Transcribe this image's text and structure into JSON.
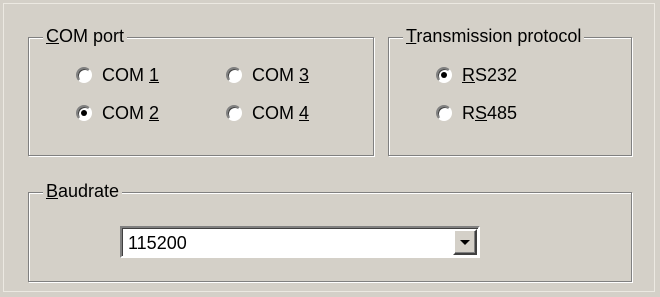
{
  "com_port": {
    "legend_first": "C",
    "legend_rest": "OM port",
    "options": [
      {
        "prefix": "COM ",
        "accel": "1",
        "selected": false
      },
      {
        "prefix": "COM ",
        "accel": "2",
        "selected": true
      },
      {
        "prefix": "COM ",
        "accel": "3",
        "selected": false
      },
      {
        "prefix": "COM ",
        "accel": "4",
        "selected": false
      }
    ]
  },
  "protocol": {
    "legend_first": "T",
    "legend_rest": "ransmission protocol",
    "options": [
      {
        "pre": "",
        "accel": "R",
        "post": "S232",
        "selected": true
      },
      {
        "pre": "R",
        "accel": "S",
        "post": "485",
        "selected": false
      }
    ]
  },
  "baudrate": {
    "legend_first": "B",
    "legend_rest": "audrate",
    "value": "115200"
  },
  "colors": {
    "face": "#d4d0c8",
    "shadow": "#808080",
    "highlight": "#ffffff"
  },
  "icons": {
    "dropdown": "chevron-down-icon"
  }
}
